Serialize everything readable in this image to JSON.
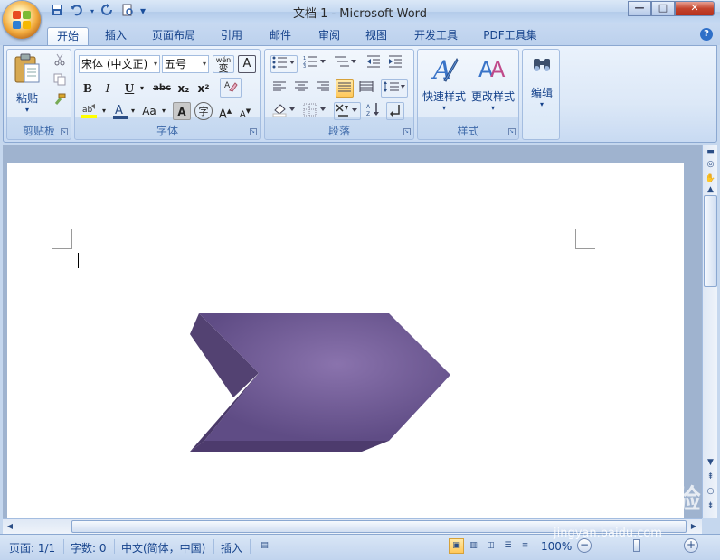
{
  "window": {
    "title": "文档 1 - Microsoft Word",
    "min_label": "—",
    "max_label": "□",
    "close_label": "✕"
  },
  "qat": {
    "save_icon": "save-icon",
    "undo_icon": "undo-icon",
    "redo_icon": "redo-icon",
    "preview_icon": "print-preview-icon",
    "customize_label": "▾"
  },
  "tabs": [
    {
      "label": "开始",
      "active": true
    },
    {
      "label": "插入"
    },
    {
      "label": "页面布局"
    },
    {
      "label": "引用"
    },
    {
      "label": "邮件"
    },
    {
      "label": "审阅"
    },
    {
      "label": "视图"
    },
    {
      "label": "开发工具"
    },
    {
      "label": "PDF工具集"
    }
  ],
  "help_label": "?",
  "ribbon": {
    "clipboard": {
      "label": "剪贴板",
      "paste_label": "粘贴",
      "paste_arrow": "▾"
    },
    "font": {
      "label": "字体",
      "font_name": "宋体 (中文正)",
      "font_size": "五号",
      "bold": "B",
      "italic": "I",
      "underline": "U",
      "strike": "abc",
      "subscript": "x₂",
      "superscript": "x²",
      "change_case": "Aa",
      "grow": "A",
      "shrink": "A",
      "enclosed": "字",
      "phonetic": "wén",
      "phonetic_char": "变",
      "char_border": "A"
    },
    "paragraph": {
      "label": "段落"
    },
    "styles": {
      "label": "样式",
      "quick_styles": "快速样式",
      "change_styles": "更改样式"
    },
    "editing": {
      "label": "编辑"
    }
  },
  "status": {
    "page": "页面: 1/1",
    "words": "字数: 0",
    "language": "中文(简体，中国)",
    "mode": "插入",
    "zoom": "100%",
    "zoom_minus": "−",
    "zoom_plus": "+"
  },
  "watermark": {
    "brand": "Baidu 经验",
    "url": "jingyan.baidu.com"
  },
  "colors": {
    "shape_fill": "#6b5591",
    "shape_dark": "#4d3b6d",
    "shape_light": "#8a73ad",
    "accent_blue": "#15428b"
  }
}
